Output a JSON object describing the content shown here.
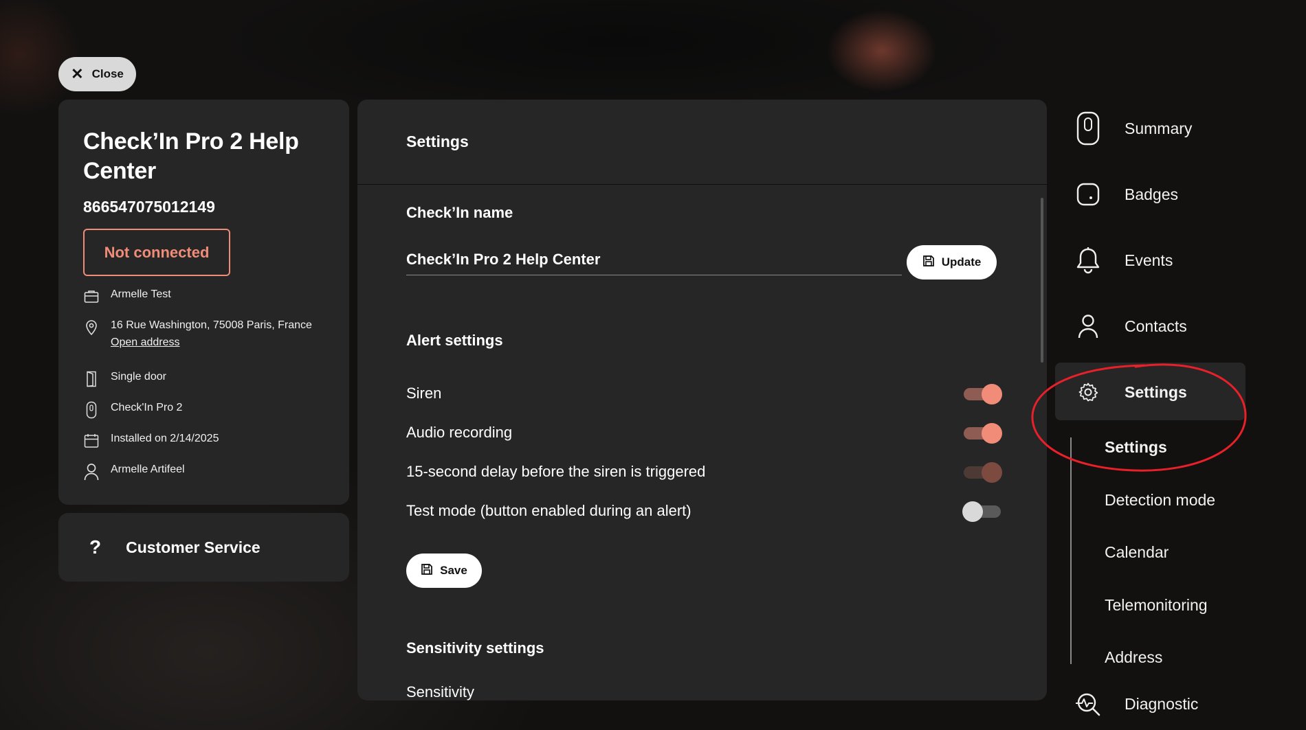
{
  "close_button": {
    "label": "Close"
  },
  "device": {
    "title": "Check’In Pro 2 Help Center",
    "serial": "866547075012149",
    "status": "Not connected",
    "organization": "Armelle Test",
    "address": "16 Rue Washington, 75008 Paris, France",
    "open_address_link": "Open address",
    "door_type": "Single door",
    "model": "Check'In Pro 2",
    "installed": "Installed on 2/14/2025",
    "installer": "Armelle Artifeel"
  },
  "customer_service": {
    "icon": "?",
    "label": "Customer Service"
  },
  "main": {
    "header": "Settings",
    "name_section": {
      "title": "Check’In name",
      "value": "Check’In Pro 2 Help Center",
      "update_label": "Update"
    },
    "alert_section": {
      "title": "Alert settings",
      "toggles": [
        {
          "label": "Siren",
          "state": "on"
        },
        {
          "label": "Audio recording",
          "state": "on"
        },
        {
          "label": "15-second delay before the siren is triggered",
          "state": "on-disabled"
        },
        {
          "label": "Test mode (button enabled during an alert)",
          "state": "off"
        }
      ],
      "save_label": "Save"
    },
    "sensitivity_section": {
      "title": "Sensitivity settings",
      "first_item": "Sensitivity"
    }
  },
  "nav": {
    "items": [
      {
        "label": "Summary",
        "icon": "device-icon"
      },
      {
        "label": "Badges",
        "icon": "badge-icon"
      },
      {
        "label": "Events",
        "icon": "bell-icon"
      },
      {
        "label": "Contacts",
        "icon": "person-icon"
      },
      {
        "label": "Settings",
        "icon": "gear-icon",
        "active": true
      },
      {
        "label": "Diagnostic",
        "icon": "diagnostic-icon"
      }
    ],
    "settings_sub": [
      "Settings",
      "Detection mode",
      "Calendar",
      "Telemonitoring",
      "Address"
    ]
  },
  "colors": {
    "accent": "#f08c78",
    "panel": "#262626",
    "annotation": "#e8202a"
  }
}
